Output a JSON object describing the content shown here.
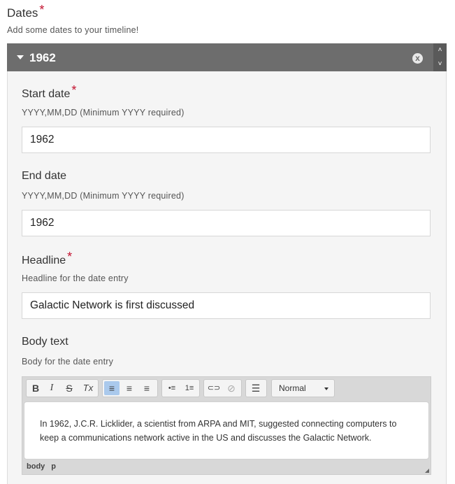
{
  "section": {
    "title": "Dates",
    "required_mark": "*",
    "description": "Add some dates to your timeline!"
  },
  "panel": {
    "title": "1962",
    "remove_icon": "x",
    "move_up_icon": "˄",
    "move_down_icon": "˅"
  },
  "fields": {
    "start_date": {
      "label": "Start date",
      "required_mark": "*",
      "description": "YYYY,MM,DD (Minimum YYYY required)",
      "value": "1962"
    },
    "end_date": {
      "label": "End date",
      "description": "YYYY,MM,DD (Minimum YYYY required)",
      "value": "1962"
    },
    "headline": {
      "label": "Headline",
      "required_mark": "*",
      "description": "Headline for the date entry",
      "value": "Galactic Network is first discussed"
    },
    "body_text": {
      "label": "Body text",
      "description": "Body for the date entry"
    }
  },
  "editor": {
    "toolbar": {
      "bold": "B",
      "italic": "I",
      "strike": "S",
      "remove_format": "Tx",
      "align_left": "≡",
      "align_center": "≡",
      "align_right": "≡",
      "bulleted_list": "•≡",
      "numbered_list": "1≡",
      "link": "⊂⊃",
      "unlink": "⊘",
      "horizontal_rule": "☰",
      "format_value": "Normal"
    },
    "content": "In 1962, J.C.R. Licklider, a scientist from ARPA and MIT, suggested connecting computers to keep a communications network active in the US and discusses the Galactic Network.",
    "path": [
      "body",
      "p"
    ]
  }
}
